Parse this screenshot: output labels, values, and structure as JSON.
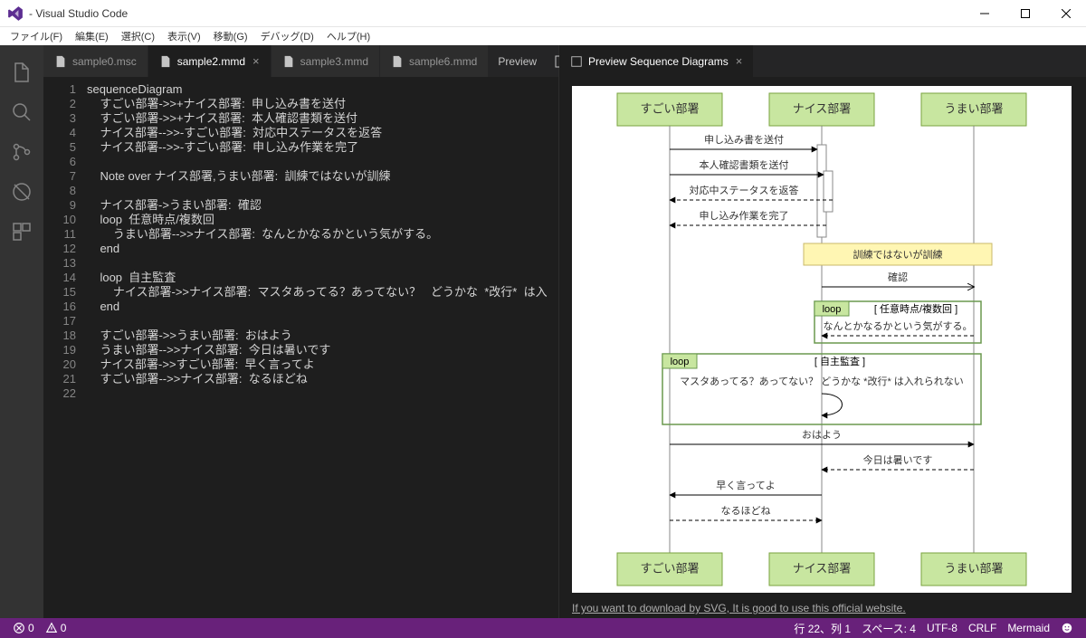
{
  "window": {
    "title": "- Visual Studio Code"
  },
  "menubar": {
    "items": [
      "ファイル(F)",
      "編集(E)",
      "選択(C)",
      "表示(V)",
      "移動(G)",
      "デバッグ(D)",
      "ヘルプ(H)"
    ]
  },
  "left_tabs": {
    "items": [
      {
        "label": "sample0.msc"
      },
      {
        "label": "sample2.mmd",
        "active": true
      },
      {
        "label": "sample3.mmd"
      },
      {
        "label": "sample6.mmd"
      }
    ],
    "action": "Preview"
  },
  "right_tabs": {
    "items": [
      {
        "label": "Preview Sequence Diagrams",
        "active": true
      }
    ]
  },
  "code": {
    "lines": [
      "sequenceDiagram",
      "    すごい部署->>+ナイス部署:  申し込み書を送付",
      "    すごい部署->>+ナイス部署:  本人確認書類を送付",
      "    ナイス部署-->>-すごい部署:  対応中ステータスを返答",
      "    ナイス部署-->>-すごい部署:  申し込み作業を完了",
      "",
      "    Note over ナイス部署,うまい部署:  訓練ではないが訓練",
      "",
      "    ナイス部署->うまい部署:  確認",
      "    loop  任意時点/複数回",
      "        うまい部署-->>ナイス部署:  なんとかなるかという気がする。",
      "    end",
      "",
      "    loop  自主監査",
      "        ナイス部署->>ナイス部署:  マスタあってる？あってない？   どうかな  *改行*  は入",
      "    end",
      "",
      "    すごい部署->>うまい部署:  おはよう",
      "    うまい部署-->>ナイス部署:  今日は暑いです",
      "    ナイス部署->>すごい部署:  早く言ってよ",
      "    すごい部署-->>ナイス部署:  なるほどね",
      ""
    ]
  },
  "chart_data": {
    "type": "sequence",
    "actors": [
      "すごい部署",
      "ナイス部署",
      "うまい部署"
    ],
    "messages": [
      {
        "from": "すごい部署",
        "to": "ナイス部署",
        "text": "申し込み書を送付",
        "style": "solid"
      },
      {
        "from": "すごい部署",
        "to": "ナイス部署",
        "text": "本人確認書類を送付",
        "style": "solid"
      },
      {
        "from": "ナイス部署",
        "to": "すごい部署",
        "text": "対応中ステータスを返答",
        "style": "dashed"
      },
      {
        "from": "ナイス部署",
        "to": "すごい部署",
        "text": "申し込み作業を完了",
        "style": "dashed"
      }
    ],
    "note": {
      "over": [
        "ナイス部署",
        "うまい部署"
      ],
      "text": "訓練ではないが訓練"
    },
    "confirm_msg": {
      "from": "ナイス部署",
      "to": "うまい部署",
      "text": "確認",
      "style": "solid-open"
    },
    "loop1": {
      "label": "loop",
      "title": "[ 任意時点/複数回 ]",
      "body": "なんとかなるかという気がする。"
    },
    "loop2": {
      "label": "loop",
      "title": "[ 自主監査 ]",
      "body": "マスタあってる？あってない？  どうかな *改行* は入れられない"
    },
    "tail_messages": [
      {
        "from": "すごい部署",
        "to": "うまい部署",
        "text": "おはよう",
        "style": "solid"
      },
      {
        "from": "うまい部署",
        "to": "ナイス部署",
        "text": "今日は暑いです",
        "style": "dashed"
      },
      {
        "from": "ナイス部署",
        "to": "すごい部署",
        "text": "早く言ってよ",
        "style": "solid"
      },
      {
        "from": "すごい部署",
        "to": "ナイス部署",
        "text": "なるほどね",
        "style": "dashed"
      }
    ]
  },
  "preview": {
    "download_link": "If you want to download by SVG, It is good to use this official website."
  },
  "statusbar": {
    "errors": "0",
    "warnings": "0",
    "cursor": "行 22、列 1",
    "spaces": "スペース: 4",
    "encoding": "UTF-8",
    "eol": "CRLF",
    "lang": "Mermaid"
  }
}
